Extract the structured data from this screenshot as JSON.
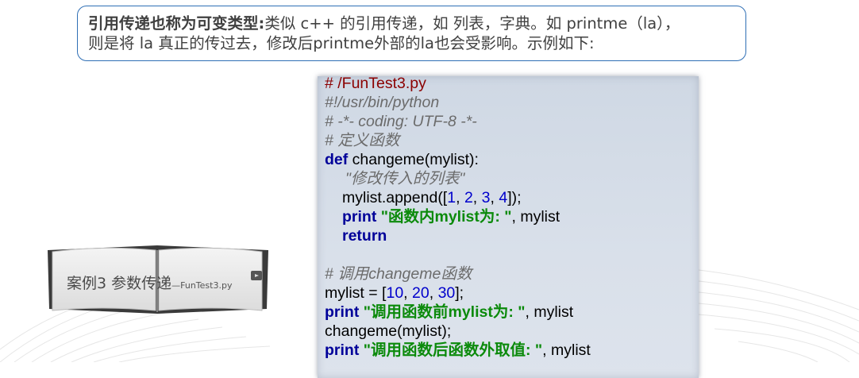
{
  "note": {
    "bold": "引用传递也称为可变类型:",
    "line1_rest": "类似 c++ 的引用传递，如 列表，字典。如 printme（la），",
    "line2": "则是将 la 真正的传过去，修改后printme外部的la也会受影响。示例如下:"
  },
  "book": {
    "title": "案例3 参数传递",
    "subtitle": "—FunTest3.py"
  },
  "code": {
    "l1": "# /FunTest3.py",
    "l2": "#!/usr/bin/python",
    "l3": "# -*- coding: UTF-8 -*-",
    "l4": "# 定义函数",
    "l5_kw": "def",
    "l5_rest": " changeme(mylist):",
    "l6": "\"修改传入的列表\"",
    "l7_a": "mylist.append([",
    "l7_n1": "1",
    "l7_s1": ", ",
    "l7_n2": "2",
    "l7_s2": ", ",
    "l7_n3": "3",
    "l7_s3": ", ",
    "l7_n4": "4",
    "l7_b": "]);",
    "l8_kw": "print",
    "l8_str": " \"函数内mylist为: \"",
    "l8_rest": ", mylist",
    "l9_kw": "return",
    "l11": "# 调用changeme函数",
    "l12_a": "mylist = [",
    "l12_n1": "10",
    "l12_s1": ", ",
    "l12_n2": "20",
    "l12_s2": ", ",
    "l12_n3": "30",
    "l12_b": "];",
    "l13_kw": "print",
    "l13_str": " \"调用函数前mylist为: \"",
    "l13_rest": ", mylist",
    "l14": "changeme(mylist);",
    "l15_kw": "print",
    "l15_str": " \"调用函数后函数外取值: \"",
    "l15_rest": ", mylist"
  }
}
